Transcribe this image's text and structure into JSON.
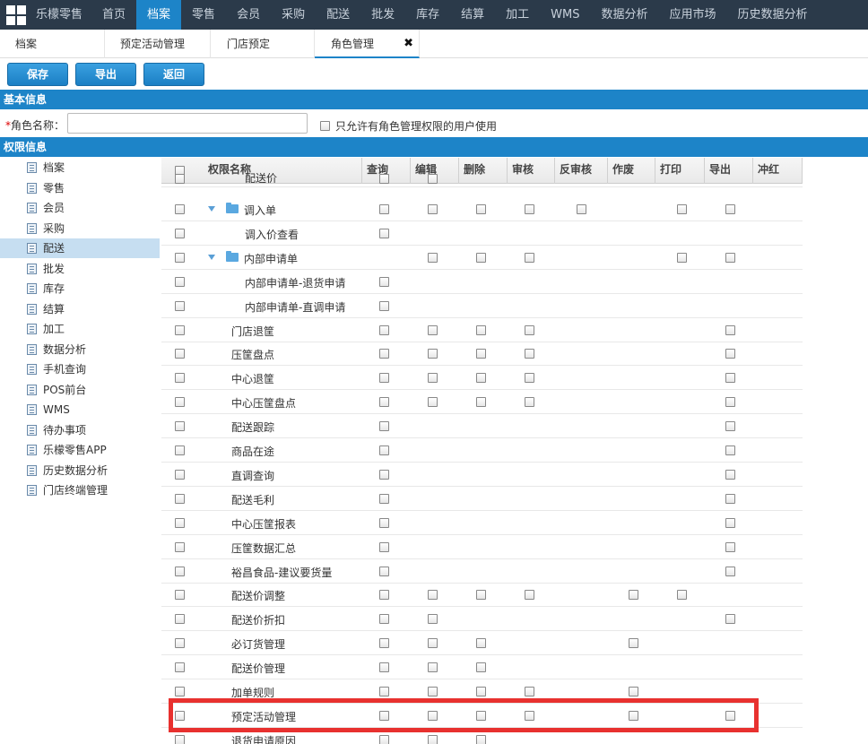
{
  "topnav": {
    "brand": "乐檬零售",
    "items": [
      "首页",
      "档案",
      "零售",
      "会员",
      "采购",
      "配送",
      "批发",
      "库存",
      "结算",
      "加工",
      "WMS",
      "数据分析",
      "应用市场",
      "历史数据分析"
    ],
    "active_index": 1
  },
  "tabs": [
    {
      "label": "档案"
    },
    {
      "label": "预定活动管理"
    },
    {
      "label": "门店预定"
    },
    {
      "label": "角色管理",
      "close": "✖"
    }
  ],
  "toolbar": {
    "save": "保存",
    "export": "导出",
    "back": "返回"
  },
  "basic_info": {
    "title": "基本信息",
    "role_name_label": "角色名称：",
    "required_mark": "*",
    "role_name_value": "",
    "only_perm_label": "只允许有角色管理权限的用户使用"
  },
  "perm_info": {
    "title": "权限信息"
  },
  "tree": {
    "items": [
      "档案",
      "零售",
      "会员",
      "采购",
      "配送",
      "批发",
      "库存",
      "结算",
      "加工",
      "数据分析",
      "手机查询",
      "POS前台",
      "WMS",
      "待办事项",
      "乐檬零售APP",
      "历史数据分析",
      "门店终端管理"
    ],
    "active_index": 4
  },
  "grid": {
    "columns": [
      "权限名称",
      "查询",
      "编辑",
      "删除",
      "审核",
      "反审核",
      "作废",
      "打印",
      "导出",
      "冲红"
    ],
    "rows": [
      {
        "name": "配送价",
        "level": 2,
        "folder": false,
        "cols": [
          1,
          1,
          0,
          0,
          0,
          0,
          0,
          0,
          0
        ]
      },
      {
        "name": "调入单",
        "level": 1,
        "folder": true,
        "cols": [
          1,
          1,
          1,
          1,
          1,
          0,
          1,
          1,
          0
        ]
      },
      {
        "name": "调入价查看",
        "level": 2,
        "folder": false,
        "cols": [
          1,
          0,
          0,
          0,
          0,
          0,
          0,
          0,
          0
        ]
      },
      {
        "name": "内部申请单",
        "level": 1,
        "folder": true,
        "cols": [
          0,
          1,
          1,
          1,
          0,
          0,
          1,
          1,
          0
        ]
      },
      {
        "name": "内部申请单-退货申请",
        "level": 2,
        "folder": false,
        "cols": [
          1,
          0,
          0,
          0,
          0,
          0,
          0,
          0,
          0
        ]
      },
      {
        "name": "内部申请单-直调申请",
        "level": 2,
        "folder": false,
        "cols": [
          1,
          0,
          0,
          0,
          0,
          0,
          0,
          0,
          0
        ]
      },
      {
        "name": "门店退筐",
        "level": 0,
        "folder": false,
        "cols": [
          1,
          1,
          1,
          1,
          0,
          0,
          0,
          1,
          0
        ]
      },
      {
        "name": "压筐盘点",
        "level": 0,
        "folder": false,
        "cols": [
          1,
          1,
          1,
          1,
          0,
          0,
          0,
          1,
          0
        ]
      },
      {
        "name": "中心退筐",
        "level": 0,
        "folder": false,
        "cols": [
          1,
          1,
          1,
          1,
          0,
          0,
          0,
          1,
          0
        ]
      },
      {
        "name": "中心压筐盘点",
        "level": 0,
        "folder": false,
        "cols": [
          1,
          1,
          1,
          1,
          0,
          0,
          0,
          1,
          0
        ]
      },
      {
        "name": "配送跟踪",
        "level": 0,
        "folder": false,
        "cols": [
          1,
          0,
          0,
          0,
          0,
          0,
          0,
          1,
          0
        ]
      },
      {
        "name": "商品在途",
        "level": 0,
        "folder": false,
        "cols": [
          1,
          0,
          0,
          0,
          0,
          0,
          0,
          1,
          0
        ]
      },
      {
        "name": "直调查询",
        "level": 0,
        "folder": false,
        "cols": [
          1,
          0,
          0,
          0,
          0,
          0,
          0,
          1,
          0
        ]
      },
      {
        "name": "配送毛利",
        "level": 0,
        "folder": false,
        "cols": [
          1,
          0,
          0,
          0,
          0,
          0,
          0,
          1,
          0
        ]
      },
      {
        "name": "中心压筐报表",
        "level": 0,
        "folder": false,
        "cols": [
          1,
          0,
          0,
          0,
          0,
          0,
          0,
          1,
          0
        ]
      },
      {
        "name": "压筐数据汇总",
        "level": 0,
        "folder": false,
        "cols": [
          1,
          0,
          0,
          0,
          0,
          0,
          0,
          1,
          0
        ]
      },
      {
        "name": "裕昌食品-建议要货量",
        "level": 0,
        "folder": false,
        "cols": [
          1,
          0,
          0,
          0,
          0,
          0,
          0,
          1,
          0
        ]
      },
      {
        "name": "配送价调整",
        "level": 0,
        "folder": false,
        "cols": [
          1,
          1,
          1,
          1,
          0,
          1,
          1,
          0,
          0
        ]
      },
      {
        "name": "配送价折扣",
        "level": 0,
        "folder": false,
        "cols": [
          1,
          1,
          0,
          0,
          0,
          0,
          0,
          1,
          0
        ]
      },
      {
        "name": "必订货管理",
        "level": 0,
        "folder": false,
        "cols": [
          1,
          1,
          1,
          0,
          0,
          1,
          0,
          0,
          0
        ]
      },
      {
        "name": "配送价管理",
        "level": 0,
        "folder": false,
        "cols": [
          1,
          1,
          1,
          0,
          0,
          0,
          0,
          0,
          0
        ]
      },
      {
        "name": "加单规则",
        "level": 0,
        "folder": false,
        "cols": [
          1,
          1,
          1,
          1,
          0,
          1,
          0,
          0,
          0
        ]
      },
      {
        "name": "预定活动管理",
        "level": 0,
        "folder": false,
        "cols": [
          1,
          1,
          1,
          1,
          0,
          1,
          0,
          1,
          0
        ]
      },
      {
        "name": "退货申请原因",
        "level": 0,
        "folder": false,
        "cols": [
          1,
          1,
          1,
          0,
          0,
          0,
          0,
          0,
          0
        ]
      }
    ]
  },
  "colors": {
    "nav_bg": "#2b3a4a",
    "accent": "#1d84c8",
    "highlight": "#e8312f",
    "tree_active": "#c6def1"
  }
}
